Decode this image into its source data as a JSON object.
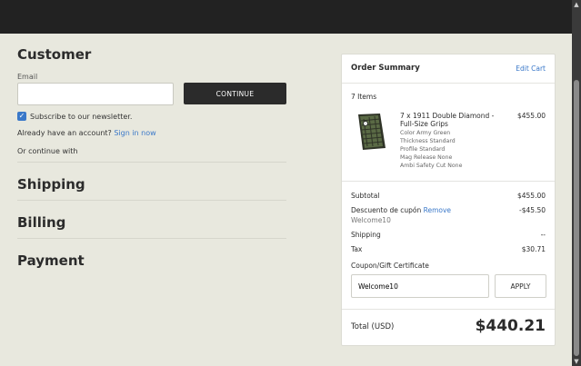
{
  "customer": {
    "heading": "Customer",
    "email_label": "Email",
    "email_value": "",
    "continue_label": "CONTINUE",
    "newsletter_label": "Subscribe to our newsletter.",
    "newsletter_checked": true,
    "account_prompt": "Already have an account?",
    "sign_in_label": "Sign in now",
    "continue_with": "Or continue with"
  },
  "sections": {
    "shipping": "Shipping",
    "billing": "Billing",
    "payment": "Payment"
  },
  "summary": {
    "title": "Order Summary",
    "edit_cart": "Edit Cart",
    "items_count": "7 Items",
    "product": {
      "name": "7 x 1911 Double Diamond - Full-Size Grips",
      "price": "$455.00",
      "options": [
        "Color Army Green",
        "Thickness Standard",
        "Profile Standard",
        "Mag Release None",
        "Ambi Safety Cut None"
      ]
    },
    "subtotal_label": "Subtotal",
    "subtotal_value": "$455.00",
    "discount_label": "Descuento de cupón",
    "discount_remove": "Remove",
    "discount_code": "Welcome10",
    "discount_value": "-$45.50",
    "shipping_label": "Shipping",
    "shipping_value": "--",
    "tax_label": "Tax",
    "tax_value": "$30.71",
    "coupon_label": "Coupon/Gift Certificate",
    "coupon_value": "Welcome10",
    "apply_label": "APPLY",
    "total_label": "Total (USD)",
    "total_value": "$440.21"
  },
  "colors": {
    "accent": "#3a78c9",
    "background": "#e8e8de",
    "dark": "#2b2b2b"
  }
}
